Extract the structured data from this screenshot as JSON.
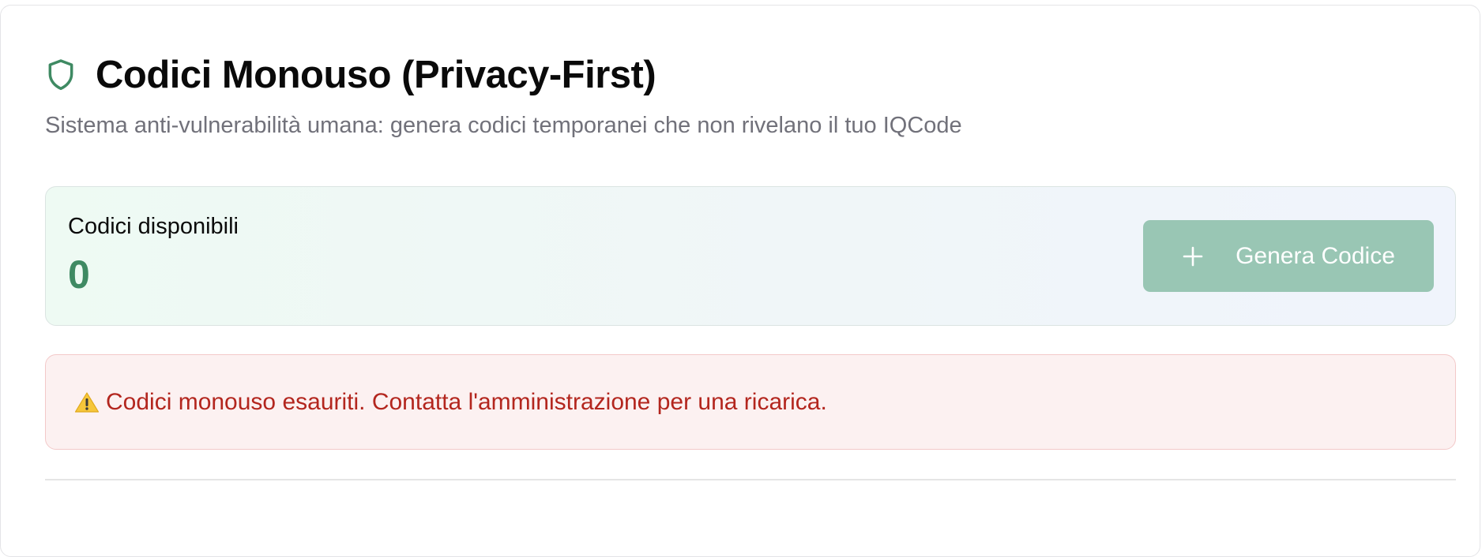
{
  "header": {
    "icon": "shield-icon",
    "title": "Codici Monouso (Privacy-First)",
    "subtitle": "Sistema anti-vulnerabilità umana: genera codici temporanei che non rivelano il tuo IQCode"
  },
  "stats": {
    "label": "Codici disponibili",
    "value": "0"
  },
  "generate_button": {
    "icon": "plus-icon",
    "label": "Genera Codice",
    "state": "disabled"
  },
  "alert": {
    "icon": "warning-icon",
    "text": "Codici monouso esauriti. Contatta l'amministrazione per una ricarica."
  },
  "colors": {
    "accent": "#3f8a63",
    "button_disabled": "#99c6b4",
    "alert_text": "#b3261e",
    "alert_bg": "#fcf1f1"
  }
}
